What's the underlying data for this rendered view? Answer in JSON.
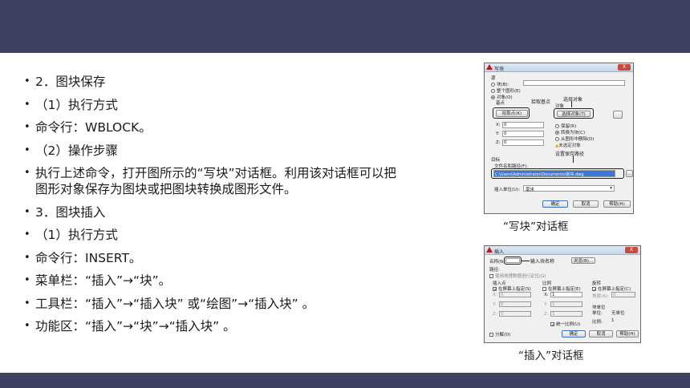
{
  "bullets": [
    "2．图块保存",
    "（1）执行方式",
    "命令行：WBLOCK。",
    "（2）操作步骤",
    "执行上述命令，打开图所示的“写块”对话框。利用该对话框可以把图形对象保存为图块或把图块转换成图形文件。",
    "3．图块插入",
    "（1）执行方式",
    "命令行：INSERT。",
    "菜单栏：“插入”→“块”。",
    "工具栏：“插入”→“插入块” 或“绘图”→“插入块” 。",
    "功能区：“插入”→“块”→“插入块” 。"
  ],
  "bullet_mark": "•",
  "wblock": {
    "title": "写块",
    "close": "X",
    "source_label": "源",
    "radio_block": "块(B):",
    "radio_whole": "整个图形(E)",
    "radio_objects": "对象(O)",
    "base_point": "基点",
    "pick_point": "拾取点(K)",
    "pick_annot": "拾取基点",
    "objects_group": "对象",
    "select_objects": "选择对象(T)",
    "select_annot": "选择对象",
    "x_label": "X:",
    "x_value": "0",
    "y_label": "Y:",
    "y_value": "0",
    "z_label": "Z:",
    "z_value": "0",
    "retain": "保留(R)",
    "convert": "转换为块(C)",
    "delete": "从图形中删除(D)",
    "not_selected": "未选定对象",
    "path_annot": "设置保存路径",
    "target": "目标",
    "file_path_label": "文件名和路径(F):",
    "file_path_value": "C:\\Users\\Administrator\\Documents\\新块.dwg",
    "browse": "...",
    "units_label": "插入单位(U):",
    "units_value": "毫米",
    "ok": "确定",
    "cancel": "取消",
    "help": "帮助(H)"
  },
  "wblock_caption": "“写块”对话框",
  "insert": {
    "title": "插入",
    "close": "X",
    "name_label": "名称(N):",
    "name_annot": "输入块名称",
    "browse": "浏览(B)...",
    "path_label": "路径:",
    "geo": "使用地理数据进行定位(G)",
    "insert_point": "插入点",
    "specify_onscreen": "在屏幕上指定(S)",
    "x": "X:",
    "x_value": "0",
    "y": "Y:",
    "y_value": "0",
    "z": "Z:",
    "z_value": "0",
    "scale": "比例",
    "scale_onscreen": "在屏幕上指定(E)",
    "sx": "X:",
    "sx_value": "1",
    "sy": "Y:",
    "sy_value": "1",
    "sz": "Z:",
    "sz_value": "1",
    "uniform": "统一比例(U)",
    "rotation": "旋转",
    "rot_onscreen": "在屏幕上指定(C)",
    "angle": "角度(A):",
    "angle_value": "0",
    "block_unit": "块单位",
    "unit": "单位:",
    "unit_value": "无单位",
    "factor": "比例:",
    "factor_value": "1",
    "explode": "分解(D)",
    "ok": "确定",
    "cancel": "取消",
    "help": "帮助(H)"
  },
  "insert_caption": "“插入”对话框"
}
